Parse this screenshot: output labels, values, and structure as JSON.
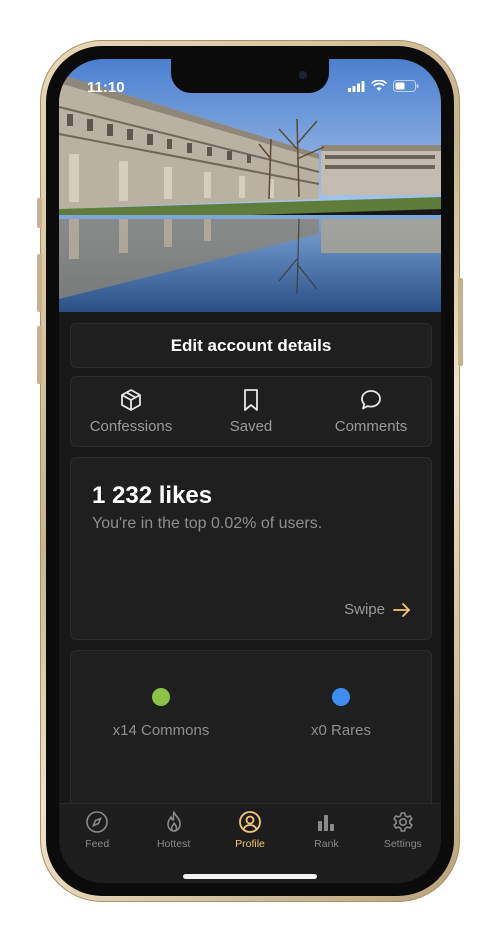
{
  "status_bar": {
    "time": "11:10"
  },
  "edit_button": {
    "label": "Edit account details"
  },
  "profile_tabs": [
    {
      "label": "Confessions",
      "icon": "cube-icon"
    },
    {
      "label": "Saved",
      "icon": "bookmark-icon"
    },
    {
      "label": "Comments",
      "icon": "chat-bubble-icon"
    }
  ],
  "likes": {
    "title": "1 232 likes",
    "subtitle": "You're in the top 0.02% of users.",
    "swipe_label": "Swipe"
  },
  "rarity": [
    {
      "label": "x14 Commons",
      "color": "#8bc34a"
    },
    {
      "label": "x0 Rares",
      "color": "#3d8ef0"
    }
  ],
  "bottom_nav": [
    {
      "label": "Feed",
      "icon": "compass-icon",
      "active": false
    },
    {
      "label": "Hottest",
      "icon": "flame-icon",
      "active": false
    },
    {
      "label": "Profile",
      "icon": "user-circle-icon",
      "active": true
    },
    {
      "label": "Rank",
      "icon": "bar-chart-icon",
      "active": false
    },
    {
      "label": "Settings",
      "icon": "gear-icon",
      "active": false
    }
  ],
  "colors": {
    "accent": "#f2c879",
    "background": "#181818",
    "card": "#1f1f1f"
  }
}
